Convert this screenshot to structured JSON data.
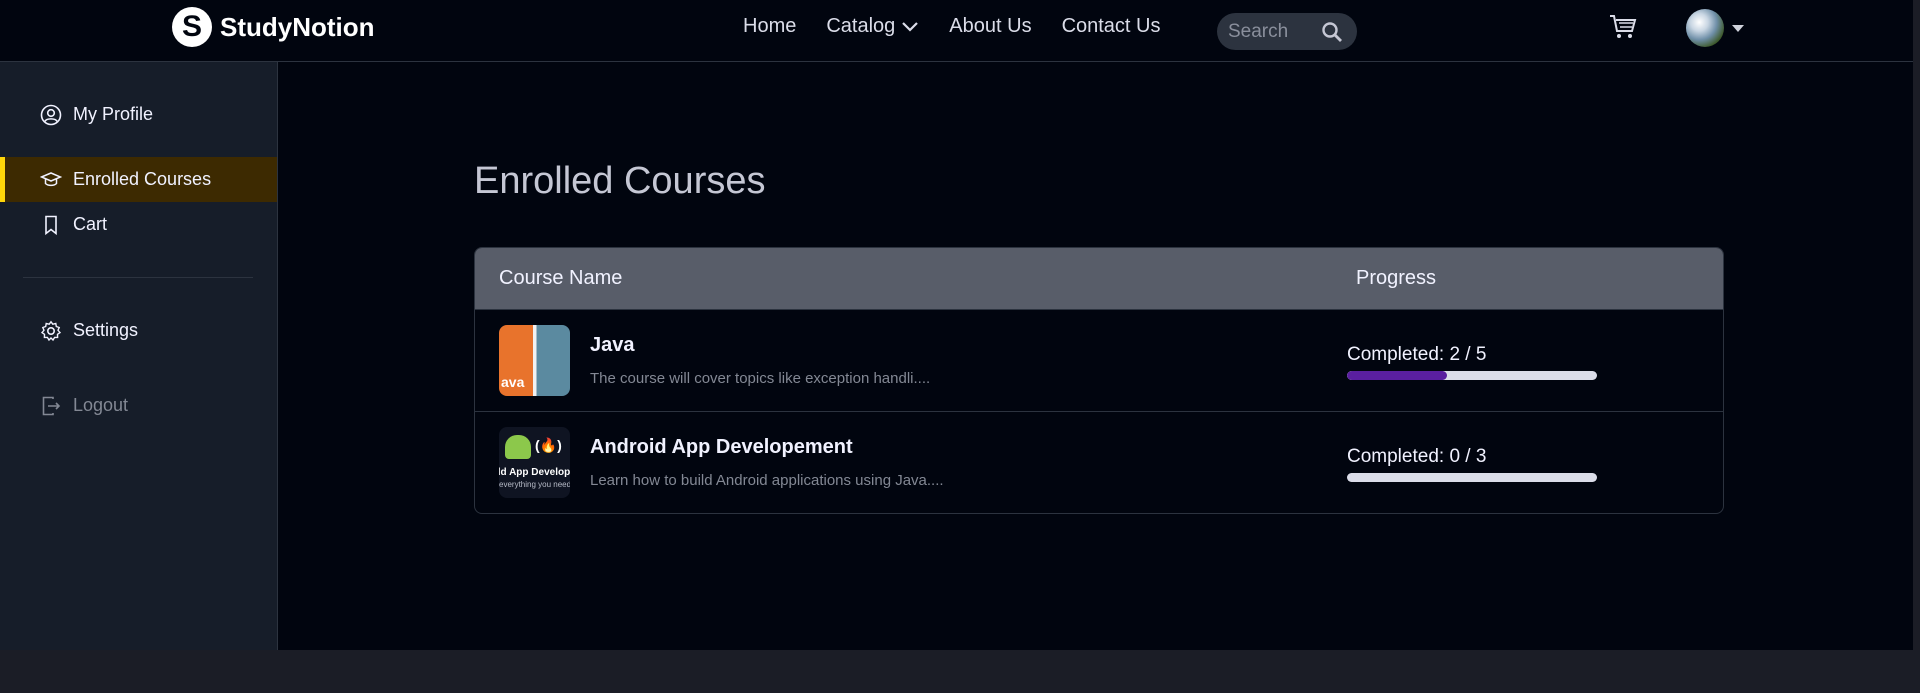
{
  "brand": {
    "name": "StudyNotion",
    "mark": "S"
  },
  "nav": {
    "links": [
      {
        "label": "Home"
      },
      {
        "label": "Catalog"
      },
      {
        "label": "About Us"
      },
      {
        "label": "Contact Us"
      }
    ],
    "search_placeholder": "Search"
  },
  "sidebar": {
    "items": [
      {
        "label": "My Profile",
        "icon": "user-circle-icon"
      },
      {
        "label": "Enrolled Courses",
        "icon": "graduation-cap-icon",
        "active": true
      },
      {
        "label": "Cart",
        "icon": "bookmark-icon"
      }
    ],
    "settings_label": "Settings",
    "logout_label": "Logout"
  },
  "page": {
    "title": "Enrolled Courses"
  },
  "table": {
    "headers": {
      "name": "Course Name",
      "progress": "Progress"
    },
    "rows": [
      {
        "title": "Java",
        "description": "The course will cover topics like exception handli....",
        "progress_text": "Completed: 2 / 5",
        "progress_fraction": 0.4,
        "thumb_text": "ava"
      },
      {
        "title": "Android App Developement",
        "description": "Learn how to build Android applications using Java....",
        "progress_text": "Completed: 0 / 3",
        "progress_fraction": 0,
        "thumb_text": "ild App Develop",
        "thumb_subtext": "everything you need to know"
      }
    ]
  },
  "colors": {
    "accent": "#ffd60a",
    "active_bg": "#3d2a01",
    "progress_fill": "#5a1fa0",
    "background": "#01050f"
  }
}
